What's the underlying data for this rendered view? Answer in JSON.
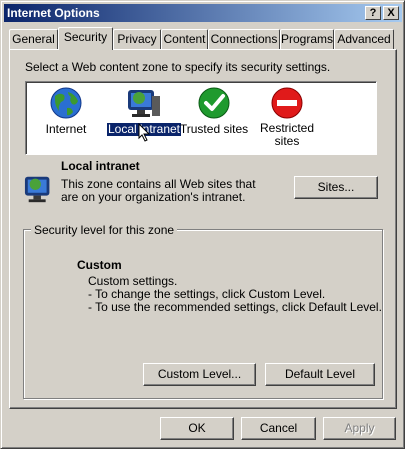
{
  "window": {
    "title": "Internet Options"
  },
  "titlebar_buttons": {
    "help": "?",
    "close": "X"
  },
  "tabs": [
    {
      "label": "General"
    },
    {
      "label": "Security",
      "active": true
    },
    {
      "label": "Privacy"
    },
    {
      "label": "Content"
    },
    {
      "label": "Connections"
    },
    {
      "label": "Programs"
    },
    {
      "label": "Advanced"
    }
  ],
  "security": {
    "instruction": "Select a Web content zone to specify its security settings.",
    "zones": [
      {
        "label": "Internet",
        "icon": "globe-icon"
      },
      {
        "label": "Local intranet",
        "icon": "intranet-icon",
        "selected": true
      },
      {
        "label": "Trusted sites",
        "icon": "checkmark-icon"
      },
      {
        "label": "Restricted sites",
        "icon": "restricted-icon"
      }
    ],
    "selected_zone": {
      "name": "Local intranet",
      "description_line1": "This zone contains all Web sites that",
      "description_line2": "are on your organization's intranet.",
      "sites_button": "Sites..."
    },
    "level": {
      "group_title": "Security level for this zone",
      "name": "Custom",
      "line1": "Custom settings.",
      "line2": "- To change the settings, click Custom Level.",
      "line3": "- To use the recommended settings, click Default Level.",
      "custom_button": "Custom Level...",
      "default_button": "Default Level"
    }
  },
  "footer": {
    "ok": "OK",
    "cancel": "Cancel",
    "apply": "Apply"
  },
  "colors": {
    "title_start": "#0a246a",
    "title_end": "#a6caf0",
    "face": "#d4d0c8",
    "selection": "#0a246a"
  }
}
